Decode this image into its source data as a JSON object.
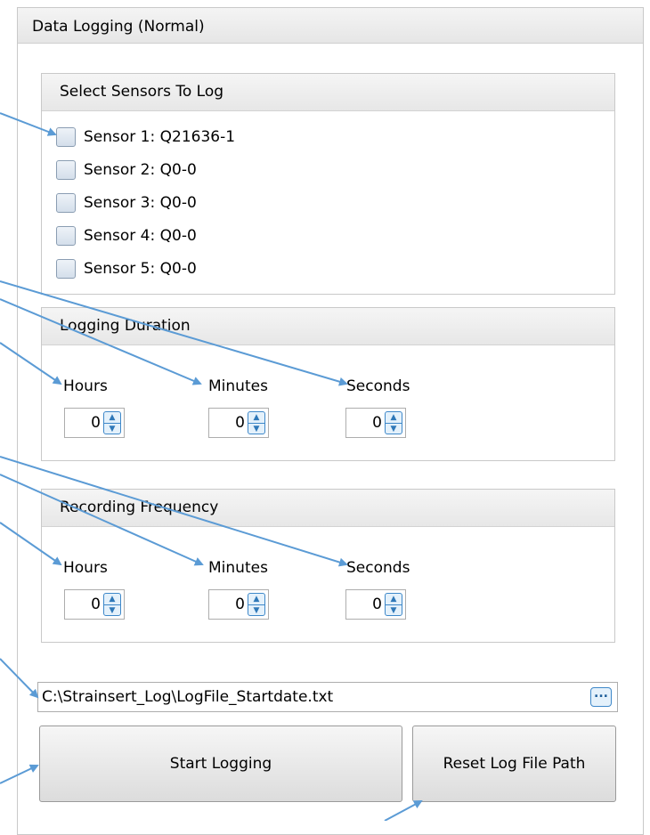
{
  "panel": {
    "title": "Data Logging (Normal)"
  },
  "sensors": {
    "title": "Select Sensors To Log",
    "items": [
      {
        "label": "Sensor 1: Q21636-1",
        "checked": false
      },
      {
        "label": "Sensor 2: Q0-0",
        "checked": false
      },
      {
        "label": "Sensor 3: Q0-0",
        "checked": false
      },
      {
        "label": "Sensor 4: Q0-0",
        "checked": false
      },
      {
        "label": "Sensor 5: Q0-0",
        "checked": false
      }
    ]
  },
  "logging_duration": {
    "title": "Logging Duration",
    "hours_label": "Hours",
    "hours_value": "0",
    "minutes_label": "Minutes",
    "minutes_value": "0",
    "seconds_label": "Seconds",
    "seconds_value": "0"
  },
  "recording_frequency": {
    "title": "Recording Frequency",
    "hours_label": "Hours",
    "hours_value": "0",
    "minutes_label": "Minutes",
    "minutes_value": "0",
    "seconds_label": "Seconds",
    "seconds_value": "0"
  },
  "log_file": {
    "path": "C:\\Strainsert_Log\\LogFile_Startdate.txt",
    "browse_label": "..."
  },
  "buttons": {
    "start": "Start Logging",
    "reset": "Reset Log File Path"
  },
  "colors": {
    "annotation_arrow": "#5b9bd5",
    "spin_accent": "#3e88c9"
  }
}
